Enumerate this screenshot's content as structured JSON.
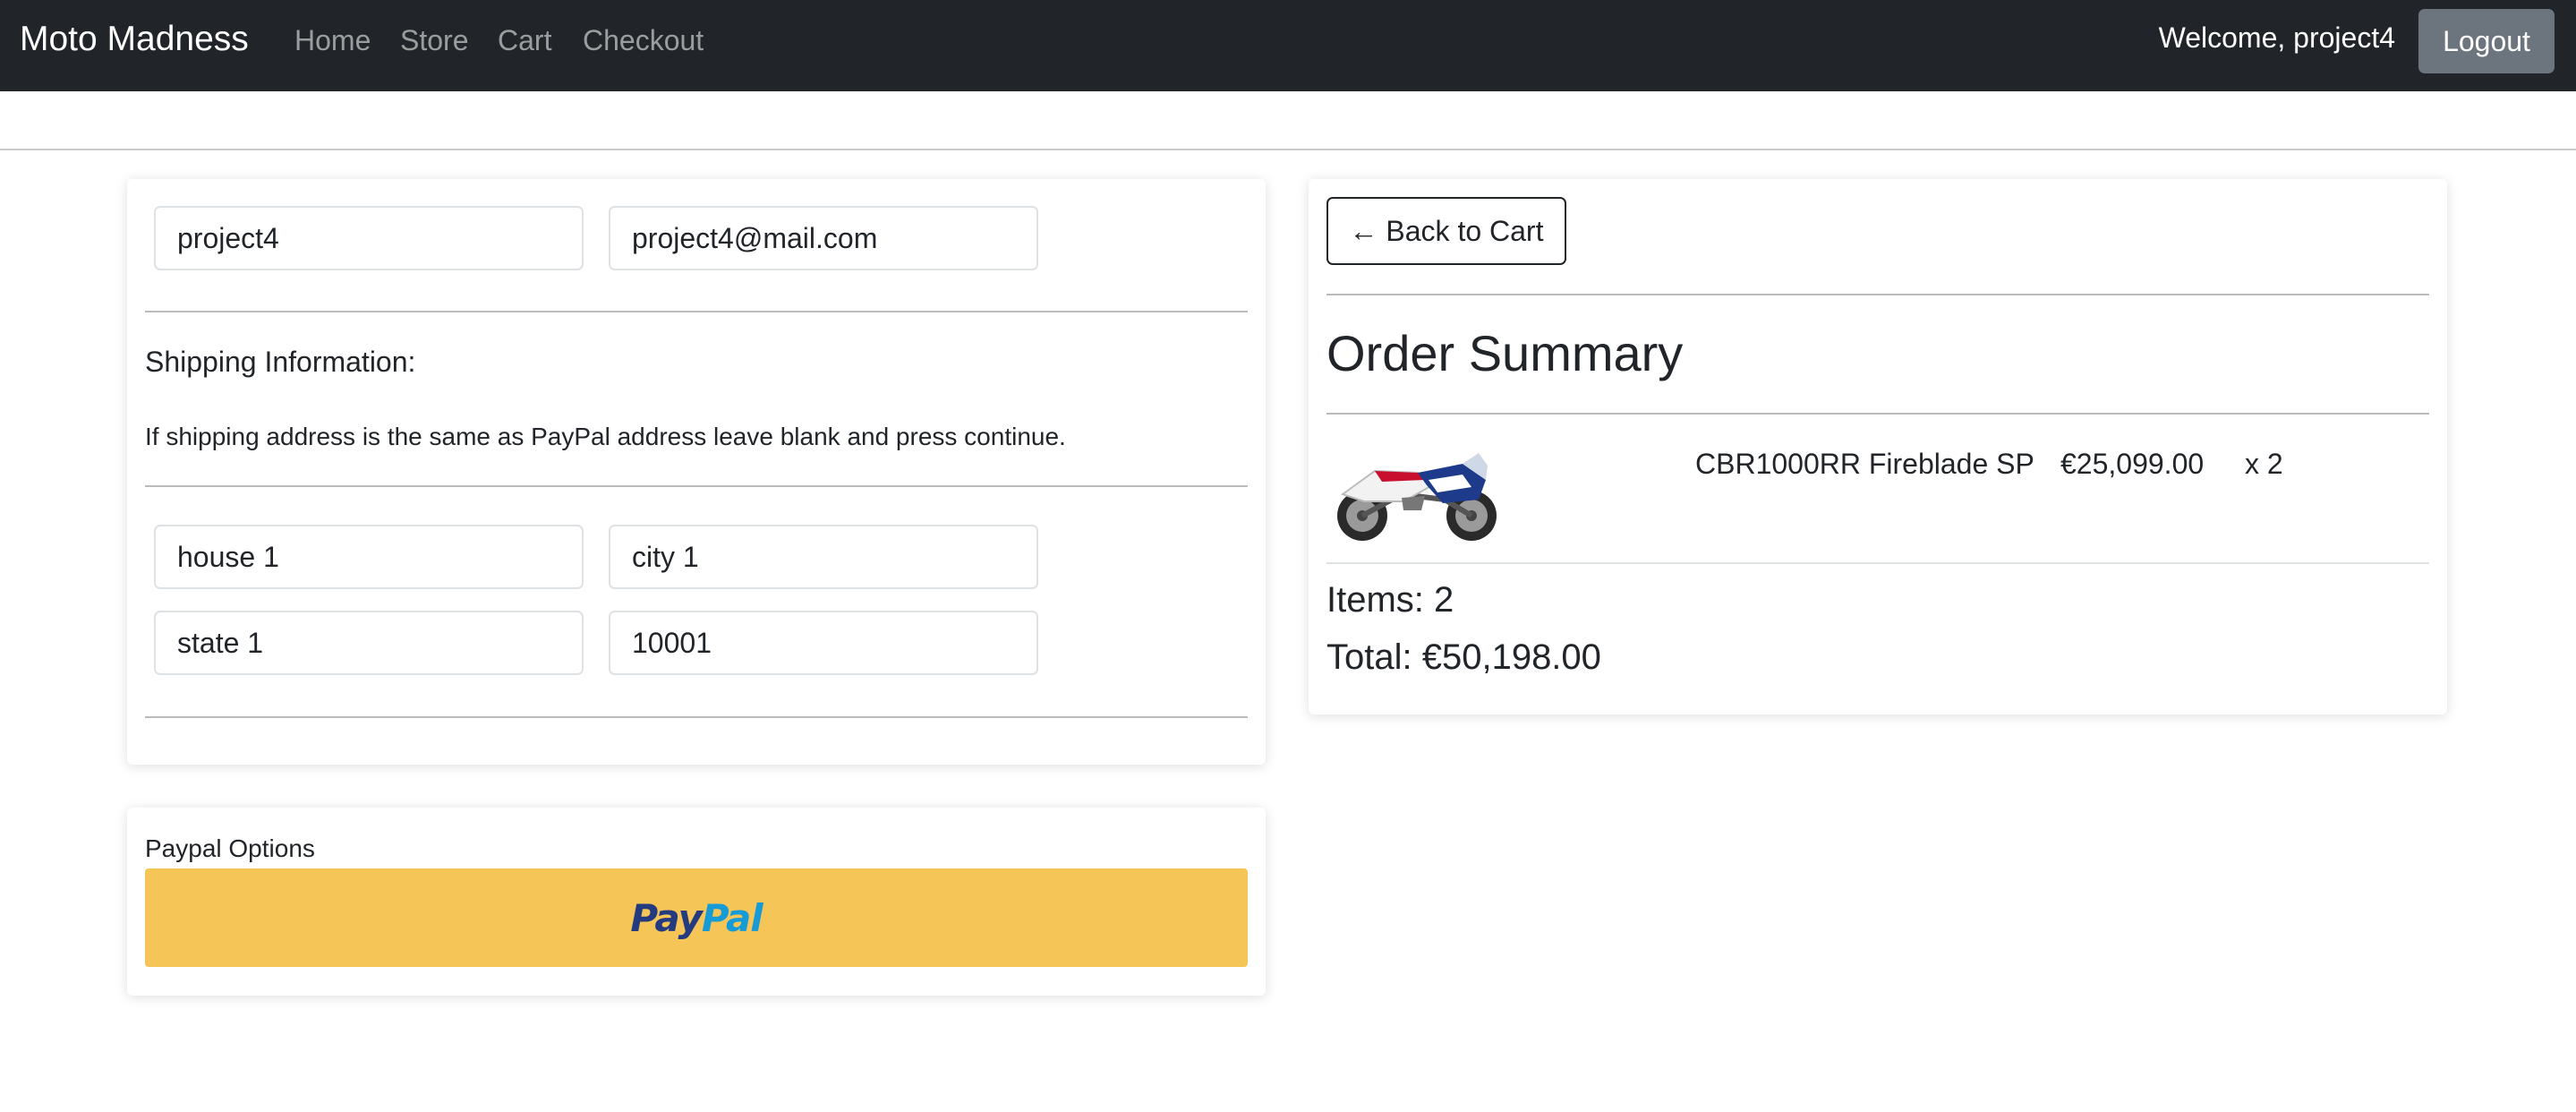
{
  "navbar": {
    "brand": "Moto Madness",
    "links": [
      "Home",
      "Store",
      "Cart",
      "Checkout"
    ],
    "welcome": "Welcome, project4",
    "logout_label": "Logout"
  },
  "customer": {
    "name": "project4",
    "email": "project4@mail.com"
  },
  "shipping": {
    "heading": "Shipping Information:",
    "note": "If shipping address is the same as PayPal address leave blank and press continue.",
    "address": "house 1",
    "city": "city 1",
    "state": "state 1",
    "zip": "10001"
  },
  "paypal": {
    "label": "Paypal Options",
    "logo_part1": "Pay",
    "logo_part2": "Pal"
  },
  "summary": {
    "back_label": "← Back to Cart",
    "title": "Order Summary",
    "items": [
      {
        "name": "CBR1000RR Fireblade SP",
        "price": "€25,099.00",
        "qty": "x 2",
        "image": "motorcycle-image"
      }
    ],
    "items_count": "Items: 2",
    "total": "Total: €50,198.00"
  },
  "colors": {
    "navbar_bg": "#212529",
    "logout_bg": "#6c757d",
    "paypal_bg": "#f6c557",
    "paypal_dark": "#253b80",
    "paypal_light": "#179bd7"
  }
}
